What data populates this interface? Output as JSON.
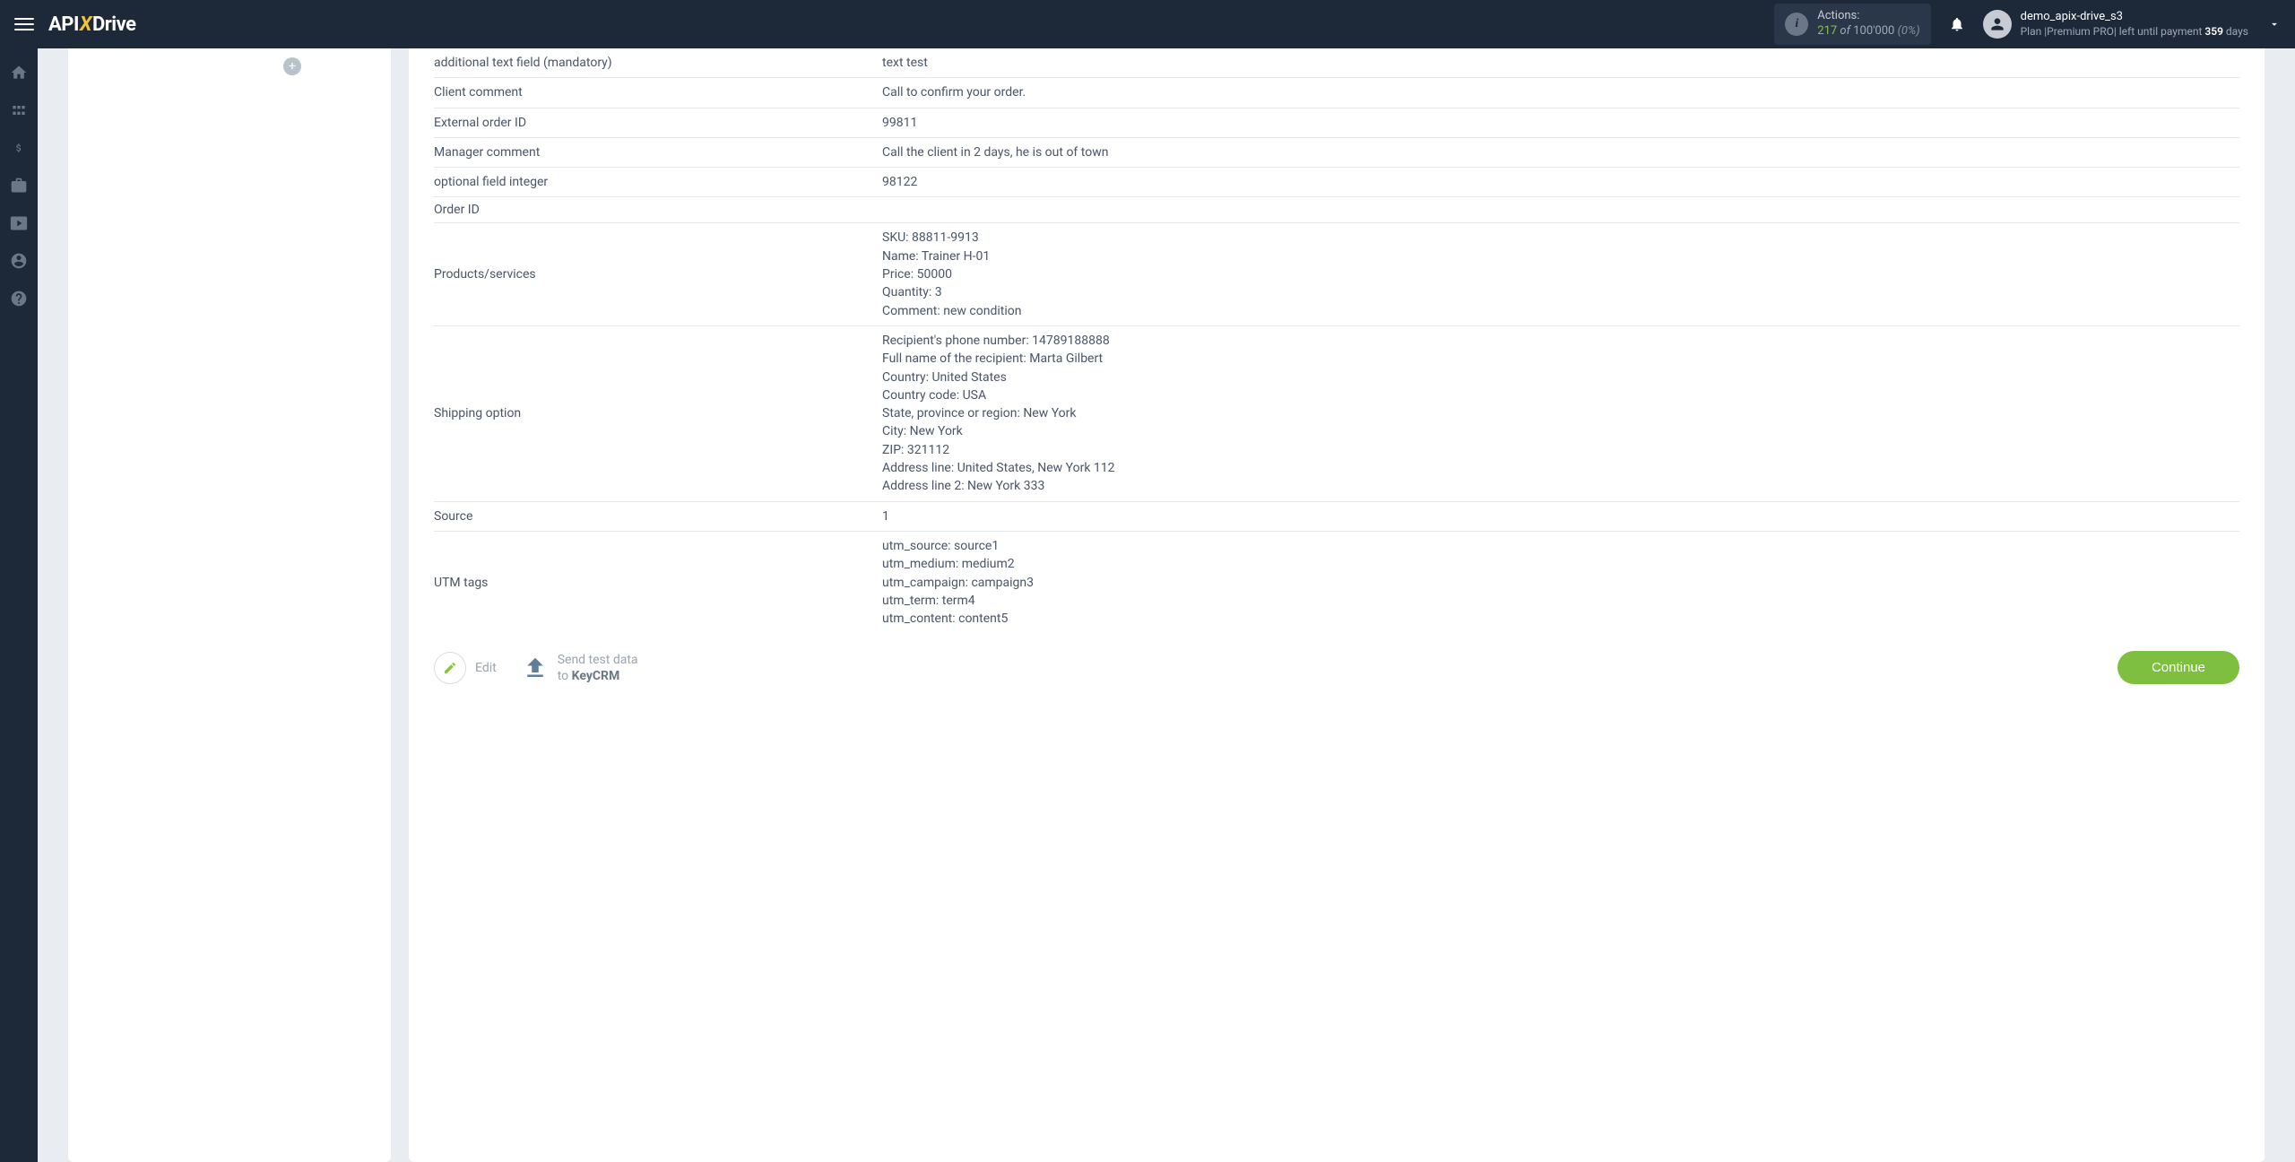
{
  "header": {
    "logo_api": "API",
    "logo_x": "X",
    "logo_drive": "Drive",
    "actions_label": "Actions:",
    "actions_count": "217",
    "actions_of": "of",
    "actions_total": "100'000",
    "actions_pct": "(0%)",
    "user_name": "demo_apix-drive_s3",
    "user_plan_prefix": "Plan |",
    "user_plan_name": "Premium PRO",
    "user_plan_mid": "| left until payment ",
    "user_plan_days": "359",
    "user_plan_suffix": " days"
  },
  "rows": [
    {
      "key": "additional text field (mandatory)",
      "val": "text test"
    },
    {
      "key": "Client comment",
      "val": "Call to confirm your order."
    },
    {
      "key": "External order ID",
      "val": "99811"
    },
    {
      "key": "Manager comment",
      "val": "Call the client in 2 days, he is out of town"
    },
    {
      "key": "optional field integer",
      "val": "98122"
    },
    {
      "key": "Order ID",
      "val": ""
    },
    {
      "key": "Products/services",
      "lines": [
        "SKU: 88811-9913",
        "Name: Trainer H-01",
        "Price: 50000",
        "Quantity: 3",
        "Comment: new condition"
      ]
    },
    {
      "key": "Shipping option",
      "lines": [
        "Recipient's phone number: 14789188888",
        "Full name of the recipient: Marta Gilbert",
        "Country: United States",
        "Country code: USA",
        "State, province or region: New York",
        "City: New York",
        "ZIP: 321112",
        "Address line: United States, New York 112",
        "Address line 2: New York 333"
      ]
    },
    {
      "key": "Source",
      "val": "1"
    },
    {
      "key": "UTM tags",
      "lines": [
        "utm_source: source1",
        "utm_medium: medium2",
        "utm_campaign: campaign3",
        "utm_term: term4",
        "utm_content: content5"
      ]
    }
  ],
  "actions": {
    "edit_label": "Edit",
    "send_line1": "Send test data",
    "send_line2_prefix": "to ",
    "send_target": "KeyCRM",
    "continue_label": "Continue"
  }
}
